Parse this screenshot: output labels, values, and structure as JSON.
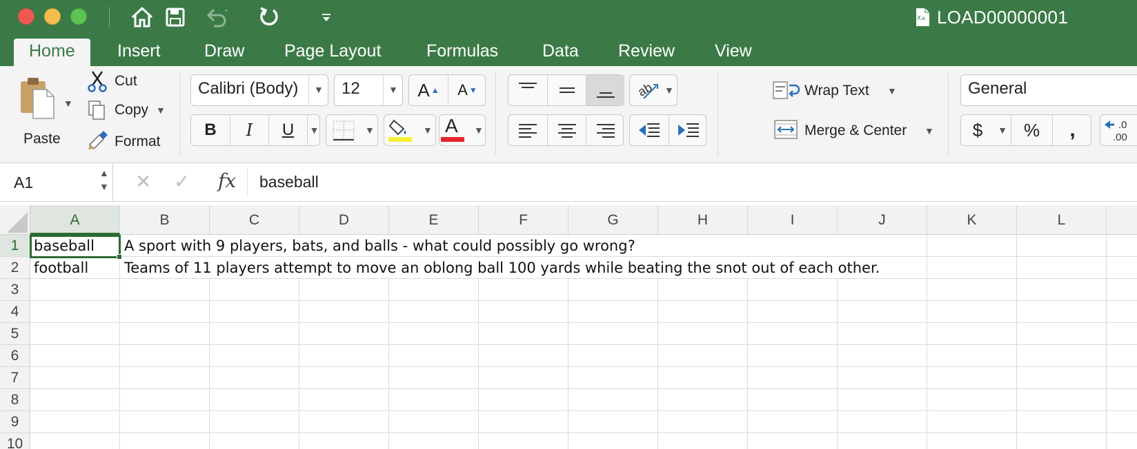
{
  "window": {
    "title": "LOAD00000001"
  },
  "tabs": [
    {
      "label": "Home",
      "active": true
    },
    {
      "label": "Insert"
    },
    {
      "label": "Draw"
    },
    {
      "label": "Page Layout"
    },
    {
      "label": "Formulas"
    },
    {
      "label": "Data"
    },
    {
      "label": "Review"
    },
    {
      "label": "View"
    }
  ],
  "clipboard": {
    "paste_label": "Paste",
    "cut_label": "Cut",
    "copy_label": "Copy",
    "format_label": "Format"
  },
  "font": {
    "family": "Calibri (Body)",
    "size": "12",
    "bold_label": "B",
    "italic_label": "I",
    "underline_label": "U",
    "grow_label": "A",
    "shrink_label": "A",
    "font_color_label": "A",
    "highlight_color": "#f6ef3a",
    "font_color": "#e3262a"
  },
  "alignment": {
    "wrap_text_label": "Wrap Text",
    "merge_center_label": "Merge & Center"
  },
  "number": {
    "format": "General",
    "currency_label": "$",
    "percent_label": "%",
    "comma_label": ",",
    "increase_decimal_label": ".0\n.00"
  },
  "formula_bar": {
    "name_box": "A1",
    "value": "baseball",
    "fx_label": "fx"
  },
  "grid": {
    "columns": [
      "A",
      "B",
      "C",
      "D",
      "E",
      "F",
      "G",
      "H",
      "I",
      "J",
      "K",
      "L"
    ],
    "rows": [
      "1",
      "2",
      "3",
      "4",
      "5",
      "6",
      "7",
      "8",
      "9",
      "10"
    ],
    "cells": {
      "A1": "baseball",
      "B1": "A sport with 9 players, bats, and balls - what could possibly go wrong?",
      "A2": "football",
      "B2": "Teams of 11 players attempt to move an oblong ball 100 yards while beating the snot out of each other."
    },
    "selected_cell": "A1"
  },
  "colors": {
    "accent": "#3b7a47",
    "selection": "#2c6b34"
  }
}
